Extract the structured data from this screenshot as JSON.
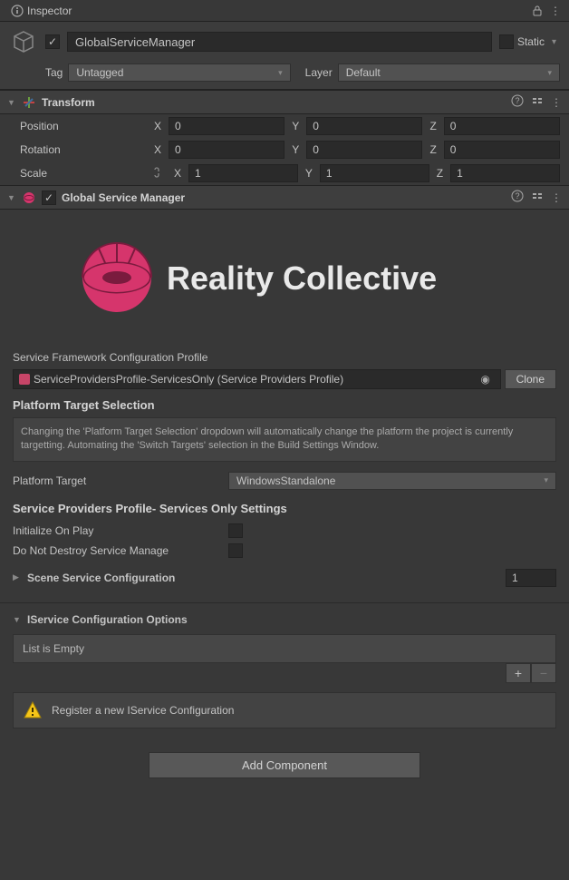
{
  "tab": {
    "title": "Inspector"
  },
  "header": {
    "enabled": true,
    "name": "GlobalServiceManager",
    "static_label": "Static",
    "static": false,
    "tag_label": "Tag",
    "tag_value": "Untagged",
    "layer_label": "Layer",
    "layer_value": "Default"
  },
  "transform": {
    "title": "Transform",
    "position": {
      "label": "Position",
      "x": "0",
      "y": "0",
      "z": "0"
    },
    "rotation": {
      "label": "Rotation",
      "x": "0",
      "y": "0",
      "z": "0"
    },
    "scale": {
      "label": "Scale",
      "x": "1",
      "y": "1",
      "z": "1"
    }
  },
  "gsm": {
    "title": "Global Service Manager",
    "enabled": true,
    "logo_text": "Reality Collective",
    "profile_label": "Service Framework Configuration Profile",
    "profile_value": "ServiceProvidersProfile-ServicesOnly (Service Providers Profile)",
    "clone_label": "Clone",
    "platform_section": "Platform Target Selection",
    "platform_help": "Changing the 'Platform Target Selection' dropdown will automatically change the platform the project is currently targetting.  Automating the 'Switch Targets' selection in the Build Settings Window.",
    "platform_label": "Platform Target",
    "platform_value": "WindowsStandalone",
    "settings_section": "Service Providers Profile- Services Only Settings",
    "init_on_play_label": "Initialize On Play",
    "init_on_play": false,
    "dnd_label": "Do Not Destroy Service Manage",
    "dnd": false,
    "scene_service_label": "Scene Service Configuration",
    "scene_service_count": "1",
    "iservice_section": "IService Configuration Options",
    "list_empty": "List is Empty",
    "warning": "Register a new IService Configuration"
  },
  "add_component": "Add Component"
}
